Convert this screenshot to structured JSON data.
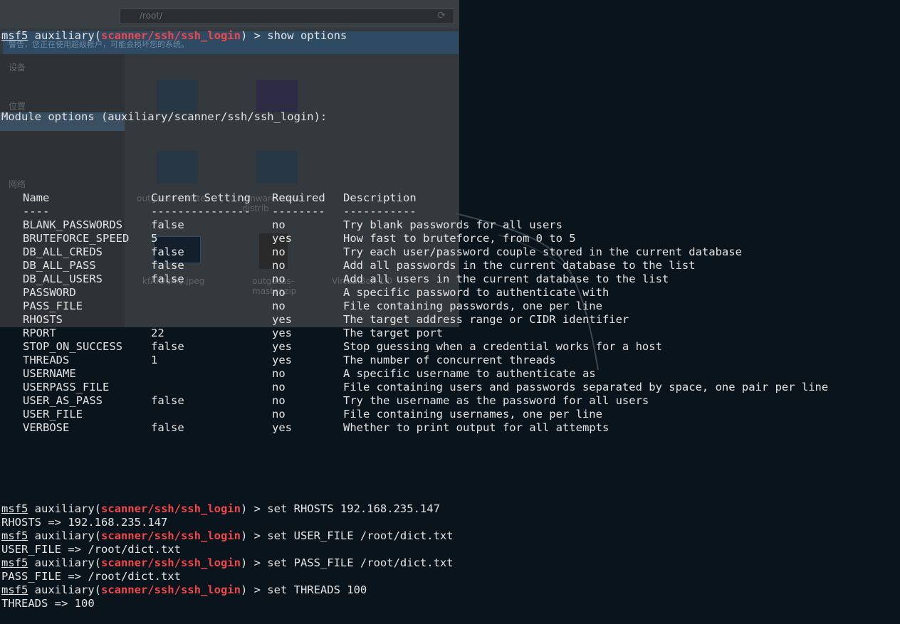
{
  "background_window": {
    "path": "/root/",
    "warning": "警告，您正在使用超级帐户，可能会损坏您的系统。",
    "sidebar_labels": [
      "设备",
      "位置",
      "网络"
    ],
    "files": [
      {
        "name": "outguess-master"
      },
      {
        "name": "vmware-tools-distrib"
      },
      {
        "name": "kfAlOqRQ.jpeg"
      },
      {
        "name": "outguess-master.zip"
      },
      {
        "name": "VirtualBox-1.0"
      }
    ]
  },
  "terminal": {
    "prompt": {
      "user": "msf5",
      "mid": " auxiliary(",
      "module": "scanner/ssh/ssh_login",
      "end": ") > "
    },
    "show_cmd": "show options",
    "module_header": "Module options (auxiliary/scanner/ssh/ssh_login):",
    "table": {
      "headers": [
        "Name",
        "Current Setting",
        "Required",
        "Description"
      ],
      "underlines": [
        "----",
        "---------------",
        "--------",
        "-----------"
      ],
      "rows": [
        [
          "BLANK_PASSWORDS",
          "false",
          "no",
          "Try blank passwords for all users"
        ],
        [
          "BRUTEFORCE_SPEED",
          "5",
          "yes",
          "How fast to bruteforce, from 0 to 5"
        ],
        [
          "DB_ALL_CREDS",
          "false",
          "no",
          "Try each user/password couple stored in the current database"
        ],
        [
          "DB_ALL_PASS",
          "false",
          "no",
          "Add all passwords in the current database to the list"
        ],
        [
          "DB_ALL_USERS",
          "false",
          "no",
          "Add all users in the current database to the list"
        ],
        [
          "PASSWORD",
          "",
          "no",
          "A specific password to authenticate with"
        ],
        [
          "PASS_FILE",
          "",
          "no",
          "File containing passwords, one per line"
        ],
        [
          "RHOSTS",
          "",
          "yes",
          "The target address range or CIDR identifier"
        ],
        [
          "RPORT",
          "22",
          "yes",
          "The target port"
        ],
        [
          "STOP_ON_SUCCESS",
          "false",
          "yes",
          "Stop guessing when a credential works for a host"
        ],
        [
          "THREADS",
          "1",
          "yes",
          "The number of concurrent threads"
        ],
        [
          "USERNAME",
          "",
          "no",
          "A specific username to authenticate as"
        ],
        [
          "USERPASS_FILE",
          "",
          "no",
          "File containing users and passwords separated by space, one pair per line"
        ],
        [
          "USER_AS_PASS",
          "false",
          "no",
          "Try the username as the password for all users"
        ],
        [
          "USER_FILE",
          "",
          "no",
          "File containing usernames, one per line"
        ],
        [
          "VERBOSE",
          "false",
          "yes",
          "Whether to print output for all attempts"
        ]
      ]
    },
    "commands": [
      {
        "cmd": "set RHOSTS 192.168.235.147",
        "output": "RHOSTS => 192.168.235.147"
      },
      {
        "cmd": "set USER_FILE /root/dict.txt",
        "output": "USER_FILE => /root/dict.txt"
      },
      {
        "cmd": "set PASS_FILE /root/dict.txt",
        "output": "PASS_FILE => /root/dict.txt"
      },
      {
        "cmd": "set THREADS 100",
        "output": "THREADS => 100"
      }
    ]
  },
  "colors": {
    "background": "#0a141c",
    "text": "#e4e4e4",
    "module": "#f0484a"
  }
}
